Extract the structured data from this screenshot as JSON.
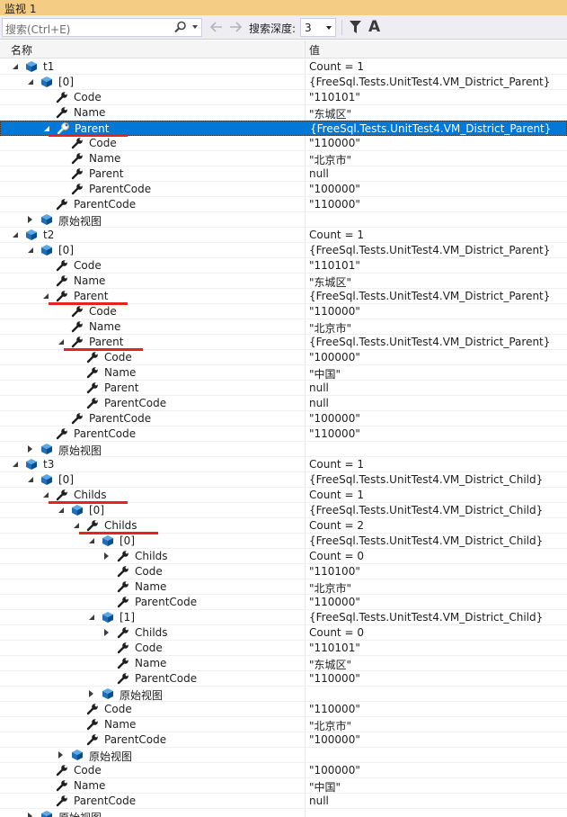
{
  "window": {
    "title": "监视 1"
  },
  "toolbar": {
    "search_placeholder": "搜索(Ctrl+E)",
    "depth_label": "搜索深度:",
    "depth_value": "3",
    "font_label": "A"
  },
  "columns": {
    "name": "名称",
    "value": "值"
  },
  "rows": [
    {
      "level": 0,
      "exp": "open",
      "icon": "cube",
      "name": "t1",
      "value": "Count = 1"
    },
    {
      "level": 1,
      "exp": "open",
      "icon": "cube",
      "name": "[0]",
      "value": "{FreeSql.Tests.UnitTest4.VM_District_Parent}"
    },
    {
      "level": 2,
      "exp": "none",
      "icon": "wrench",
      "name": "Code",
      "value": "\"110101\""
    },
    {
      "level": 2,
      "exp": "none",
      "icon": "wrench",
      "name": "Name",
      "value": "\"东城区\""
    },
    {
      "level": 2,
      "exp": "open",
      "icon": "wrench-search",
      "name": "Parent",
      "value": "{FreeSql.Tests.UnitTest4.VM_District_Parent}",
      "selected": true
    },
    {
      "level": 3,
      "exp": "none",
      "icon": "wrench",
      "name": "Code",
      "value": "\"110000\""
    },
    {
      "level": 3,
      "exp": "none",
      "icon": "wrench",
      "name": "Name",
      "value": "\"北京市\""
    },
    {
      "level": 3,
      "exp": "none",
      "icon": "wrench",
      "name": "Parent",
      "value": "null"
    },
    {
      "level": 3,
      "exp": "none",
      "icon": "wrench",
      "name": "ParentCode",
      "value": "\"100000\""
    },
    {
      "level": 2,
      "exp": "none",
      "icon": "wrench",
      "name": "ParentCode",
      "value": "\"110000\""
    },
    {
      "level": 1,
      "exp": "closed",
      "icon": "cube",
      "name": "原始视图",
      "value": ""
    },
    {
      "level": 0,
      "exp": "open",
      "icon": "cube",
      "name": "t2",
      "value": "Count = 1"
    },
    {
      "level": 1,
      "exp": "open",
      "icon": "cube",
      "name": "[0]",
      "value": "{FreeSql.Tests.UnitTest4.VM_District_Parent}"
    },
    {
      "level": 2,
      "exp": "none",
      "icon": "wrench",
      "name": "Code",
      "value": "\"110101\""
    },
    {
      "level": 2,
      "exp": "none",
      "icon": "wrench",
      "name": "Name",
      "value": "\"东城区\""
    },
    {
      "level": 2,
      "exp": "open",
      "icon": "wrench",
      "name": "Parent",
      "value": "{FreeSql.Tests.UnitTest4.VM_District_Parent}"
    },
    {
      "level": 3,
      "exp": "none",
      "icon": "wrench",
      "name": "Code",
      "value": "\"110000\""
    },
    {
      "level": 3,
      "exp": "none",
      "icon": "wrench",
      "name": "Name",
      "value": "\"北京市\""
    },
    {
      "level": 3,
      "exp": "open",
      "icon": "wrench",
      "name": "Parent",
      "value": "{FreeSql.Tests.UnitTest4.VM_District_Parent}"
    },
    {
      "level": 4,
      "exp": "none",
      "icon": "wrench",
      "name": "Code",
      "value": "\"100000\""
    },
    {
      "level": 4,
      "exp": "none",
      "icon": "wrench",
      "name": "Name",
      "value": "\"中国\""
    },
    {
      "level": 4,
      "exp": "none",
      "icon": "wrench",
      "name": "Parent",
      "value": "null"
    },
    {
      "level": 4,
      "exp": "none",
      "icon": "wrench",
      "name": "ParentCode",
      "value": "null"
    },
    {
      "level": 3,
      "exp": "none",
      "icon": "wrench",
      "name": "ParentCode",
      "value": "\"100000\""
    },
    {
      "level": 2,
      "exp": "none",
      "icon": "wrench",
      "name": "ParentCode",
      "value": "\"110000\""
    },
    {
      "level": 1,
      "exp": "closed",
      "icon": "cube",
      "name": "原始视图",
      "value": ""
    },
    {
      "level": 0,
      "exp": "open",
      "icon": "cube",
      "name": "t3",
      "value": "Count = 1"
    },
    {
      "level": 1,
      "exp": "open",
      "icon": "cube",
      "name": "[0]",
      "value": "{FreeSql.Tests.UnitTest4.VM_District_Child}"
    },
    {
      "level": 2,
      "exp": "open",
      "icon": "wrench",
      "name": "Childs",
      "value": "Count = 1"
    },
    {
      "level": 3,
      "exp": "open",
      "icon": "cube",
      "name": "[0]",
      "value": "{FreeSql.Tests.UnitTest4.VM_District_Child}"
    },
    {
      "level": 4,
      "exp": "open",
      "icon": "wrench",
      "name": "Childs",
      "value": "Count = 2"
    },
    {
      "level": 5,
      "exp": "open",
      "icon": "cube",
      "name": "[0]",
      "value": "{FreeSql.Tests.UnitTest4.VM_District_Child}"
    },
    {
      "level": 6,
      "exp": "closed",
      "icon": "wrench",
      "name": "Childs",
      "value": "Count = 0"
    },
    {
      "level": 6,
      "exp": "none",
      "icon": "wrench",
      "name": "Code",
      "value": "\"110100\""
    },
    {
      "level": 6,
      "exp": "none",
      "icon": "wrench",
      "name": "Name",
      "value": "\"北京市\""
    },
    {
      "level": 6,
      "exp": "none",
      "icon": "wrench",
      "name": "ParentCode",
      "value": "\"110000\""
    },
    {
      "level": 5,
      "exp": "open",
      "icon": "cube",
      "name": "[1]",
      "value": "{FreeSql.Tests.UnitTest4.VM_District_Child}"
    },
    {
      "level": 6,
      "exp": "closed",
      "icon": "wrench",
      "name": "Childs",
      "value": "Count = 0"
    },
    {
      "level": 6,
      "exp": "none",
      "icon": "wrench",
      "name": "Code",
      "value": "\"110101\""
    },
    {
      "level": 6,
      "exp": "none",
      "icon": "wrench",
      "name": "Name",
      "value": "\"东城区\""
    },
    {
      "level": 6,
      "exp": "none",
      "icon": "wrench",
      "name": "ParentCode",
      "value": "\"110000\""
    },
    {
      "level": 5,
      "exp": "closed",
      "icon": "cube",
      "name": "原始视图",
      "value": ""
    },
    {
      "level": 4,
      "exp": "none",
      "icon": "wrench",
      "name": "Code",
      "value": "\"110000\""
    },
    {
      "level": 4,
      "exp": "none",
      "icon": "wrench",
      "name": "Name",
      "value": "\"北京市\""
    },
    {
      "level": 4,
      "exp": "none",
      "icon": "wrench",
      "name": "ParentCode",
      "value": "\"100000\""
    },
    {
      "level": 3,
      "exp": "closed",
      "icon": "cube",
      "name": "原始视图",
      "value": ""
    },
    {
      "level": 2,
      "exp": "none",
      "icon": "wrench",
      "name": "Code",
      "value": "\"100000\""
    },
    {
      "level": 2,
      "exp": "none",
      "icon": "wrench",
      "name": "Name",
      "value": "\"中国\""
    },
    {
      "level": 2,
      "exp": "none",
      "icon": "wrench",
      "name": "ParentCode",
      "value": "null"
    },
    {
      "level": 1,
      "exp": "closed",
      "icon": "cube",
      "name": "原始视图",
      "value": ""
    }
  ],
  "annotations": {
    "color": "#e8231d",
    "underlined_rows": [
      4,
      15,
      18,
      28,
      30
    ]
  }
}
